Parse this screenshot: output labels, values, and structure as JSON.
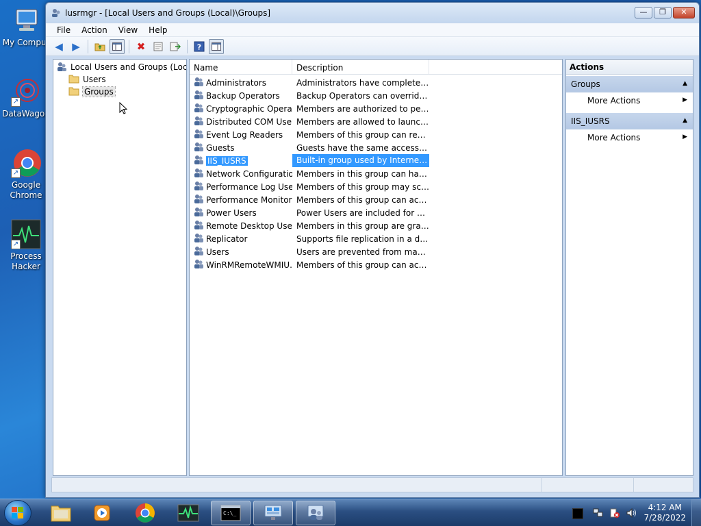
{
  "desktop": {
    "icons": [
      {
        "label": "My Comput"
      },
      {
        "label": "DataWagon"
      },
      {
        "label": "Google Chrome"
      },
      {
        "label": "Process Hacker"
      }
    ]
  },
  "window": {
    "title": "lusrmgr - [Local Users and Groups (Local)\\Groups]",
    "controls": {
      "minimize": "—",
      "restore": "❐",
      "close": "✕"
    }
  },
  "menu": [
    "File",
    "Action",
    "View",
    "Help"
  ],
  "tree": {
    "root": "Local Users and Groups (Local)",
    "children": [
      "Users",
      "Groups"
    ]
  },
  "list": {
    "columns": [
      "Name",
      "Description"
    ],
    "rows": [
      {
        "name": "Administrators",
        "desc": "Administrators have complete an..."
      },
      {
        "name": "Backup Operators",
        "desc": "Backup Operators can override se..."
      },
      {
        "name": "Cryptographic Operat...",
        "desc": "Members are authorized to perfor..."
      },
      {
        "name": "Distributed COM Users",
        "desc": "Members are allowed to launch, a..."
      },
      {
        "name": "Event Log Readers",
        "desc": "Members of this group can read e..."
      },
      {
        "name": "Guests",
        "desc": "Guests have the same access as m..."
      },
      {
        "name": "IIS_IUSRS",
        "desc": "Built-in group used by Internet Inf...",
        "selected": true
      },
      {
        "name": "Network Configuratio...",
        "desc": "Members in this group can have s..."
      },
      {
        "name": "Performance Log Users",
        "desc": "Members of this group may sche..."
      },
      {
        "name": "Performance Monitor ...",
        "desc": "Members of this group can acces..."
      },
      {
        "name": "Power Users",
        "desc": "Power Users are included for back..."
      },
      {
        "name": "Remote Desktop Users",
        "desc": "Members in this group are grante..."
      },
      {
        "name": "Replicator",
        "desc": "Supports file replication in a dom..."
      },
      {
        "name": "Users",
        "desc": "Users are prevented from making ..."
      },
      {
        "name": "WinRMRemoteWMIU...",
        "desc": "Members of this group can acces..."
      }
    ]
  },
  "actions": {
    "title": "Actions",
    "sections": [
      {
        "header": "Groups",
        "item": "More Actions"
      },
      {
        "header": "IIS_IUSRS",
        "item": "More Actions"
      }
    ]
  },
  "taskbar": {
    "time": "4:12 AM",
    "date": "7/28/2022"
  }
}
